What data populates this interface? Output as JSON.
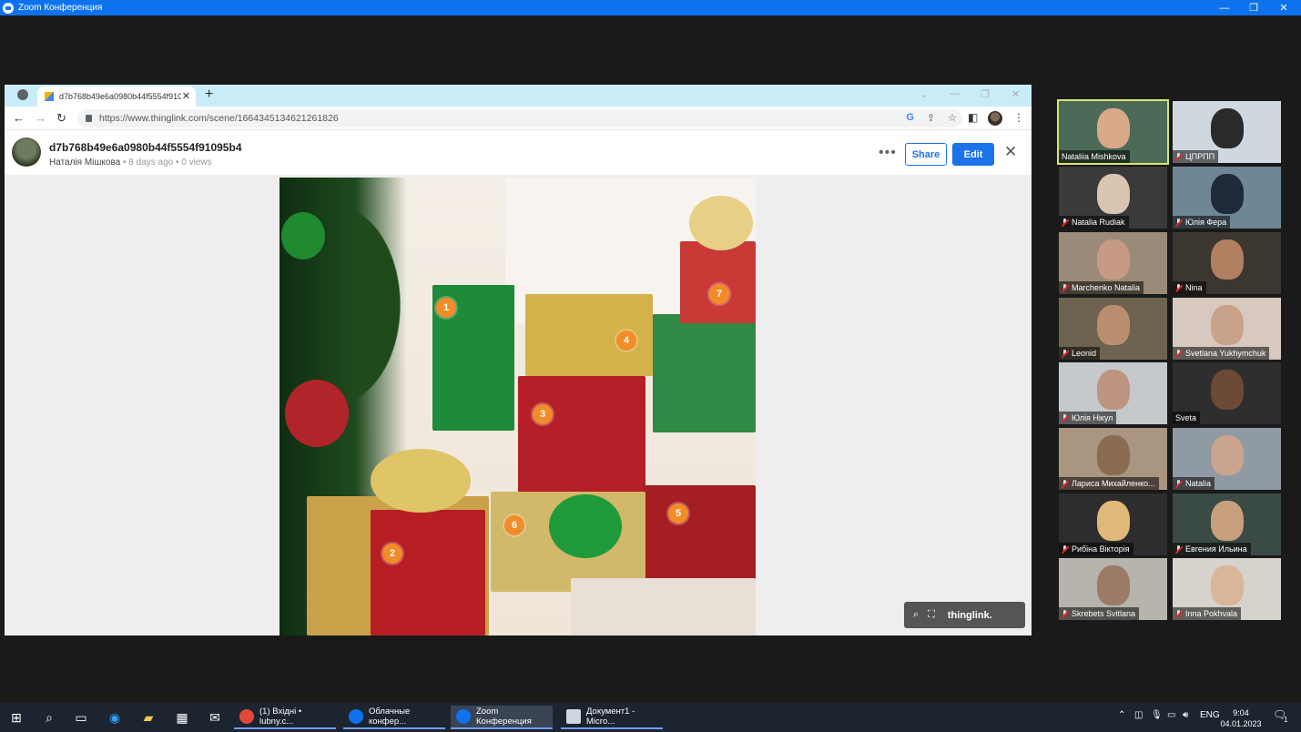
{
  "zoom_window": {
    "title": "Zoom Конференция",
    "controls": [
      "—",
      "❐",
      "✕"
    ]
  },
  "browser": {
    "tab_title": "d7b768b49e6a0980b44f5554f91095b4",
    "url": "https://www.thinglink.com/scene/1664345134621261826"
  },
  "thinglink": {
    "scene_title": "d7b768b49e6a0980b44f5554f91095b4",
    "author": "Наталія Мішкова",
    "age": "8 days ago",
    "views": "0 views",
    "share_label": "Share",
    "edit_label": "Edit",
    "brand": "thinglink.",
    "hotspots": [
      "1",
      "2",
      "3",
      "4",
      "5",
      "6",
      "7"
    ]
  },
  "participants": [
    {
      "name": "Nataliia Mishkova",
      "muted": false,
      "active": true,
      "bg": "#4b6b58",
      "face": "#d9a98a"
    },
    {
      "name": "ЦПРПП",
      "muted": true,
      "active": false,
      "bg": "#cfd8df",
      "face": "#2a2a2a"
    },
    {
      "name": "Natalia Rudiak",
      "muted": true,
      "active": false,
      "bg": "#3a3a3a",
      "face": "#d8c6b2"
    },
    {
      "name": "Юлія Фера",
      "muted": true,
      "active": false,
      "bg": "#6f8795",
      "face": "#1e2a3a"
    },
    {
      "name": "Marchenko Natalia",
      "muted": true,
      "active": false,
      "bg": "#9b8a79",
      "face": "#c79a85"
    },
    {
      "name": "Nina",
      "muted": true,
      "active": false,
      "bg": "#3c3630",
      "face": "#b08060"
    },
    {
      "name": "Leonid",
      "muted": true,
      "active": false,
      "bg": "#6e6350",
      "face": "#b98f70"
    },
    {
      "name": "Svetlana Yukhymchuk",
      "muted": true,
      "active": false,
      "bg": "#d8c9c0",
      "face": "#c9a28a"
    },
    {
      "name": "Юлія Нікул",
      "muted": true,
      "active": false,
      "bg": "#c5c9cc",
      "face": "#bd9480"
    },
    {
      "name": "Sveta",
      "muted": false,
      "active": false,
      "bg": "#2e2e2e",
      "face": "#6d4a36"
    },
    {
      "name": "Лариса Михайленко...",
      "muted": true,
      "active": false,
      "bg": "#a99580",
      "face": "#8a6c52"
    },
    {
      "name": "Natalia",
      "muted": true,
      "active": false,
      "bg": "#8f9aa4",
      "face": "#caa48c"
    },
    {
      "name": "Рибіна Вікторія",
      "muted": true,
      "active": false,
      "bg": "#2d2d2d",
      "face": "#e0b878"
    },
    {
      "name": "Евгения Ильина",
      "muted": true,
      "active": false,
      "bg": "#3a4a44",
      "face": "#c9a07e"
    },
    {
      "name": "Skrebets Svitlana",
      "muted": true,
      "active": false,
      "bg": "#b7b3ad",
      "face": "#9b7a66"
    },
    {
      "name": "Inna Pokhvala",
      "muted": true,
      "active": false,
      "bg": "#d6d2cc",
      "face": "#d9b59a"
    }
  ],
  "taskbar": {
    "apps": [
      {
        "label": "(1) Вхідні • lubny.c...",
        "icon_color": "#e04a3a",
        "active": false
      },
      {
        "label": "Облачные конфер...",
        "icon_color": "#0e72ed",
        "active": false
      },
      {
        "label": "Zoom Конференция",
        "icon_color": "#0e72ed",
        "active": true
      },
      {
        "label": "Документ1 - Micro...",
        "icon_color": "#cfd6e0",
        "active": false
      }
    ],
    "lang": "ENG",
    "time": "9:04",
    "date": "04.01.2023",
    "notification_count": "1"
  }
}
